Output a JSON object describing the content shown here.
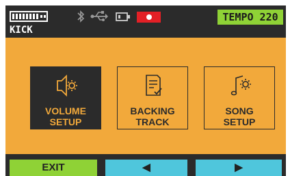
{
  "status": {
    "battery_icon": "battery-icon",
    "bluetooth_icon": "bluetooth-icon",
    "usb_icon": "usb-icon",
    "sdcard_icon": "sd-card-icon",
    "record_icon": "record-icon",
    "tempo_label": "TEMPO 220",
    "kit_name": "KICK",
    "colors": {
      "tempo_bg": "#8fd236",
      "record_bg": "#e32026"
    }
  },
  "menu": {
    "background": "#f2a93b",
    "items": [
      {
        "label_line1": "VOLUME",
        "label_line2": "SETUP",
        "icon": "speaker-gear-icon",
        "selected": true
      },
      {
        "label_line1": "BACKING",
        "label_line2": "TRACK",
        "icon": "document-check-icon",
        "selected": false
      },
      {
        "label_line1": "SONG",
        "label_line2": "SETUP",
        "icon": "music-note-gear-icon",
        "selected": false
      }
    ]
  },
  "bottom": {
    "exit_label": "EXIT",
    "prev_label": "◀",
    "next_label": "▶",
    "colors": {
      "exit_bg": "#8fd236",
      "nav_bg": "#4fc6dc"
    }
  }
}
